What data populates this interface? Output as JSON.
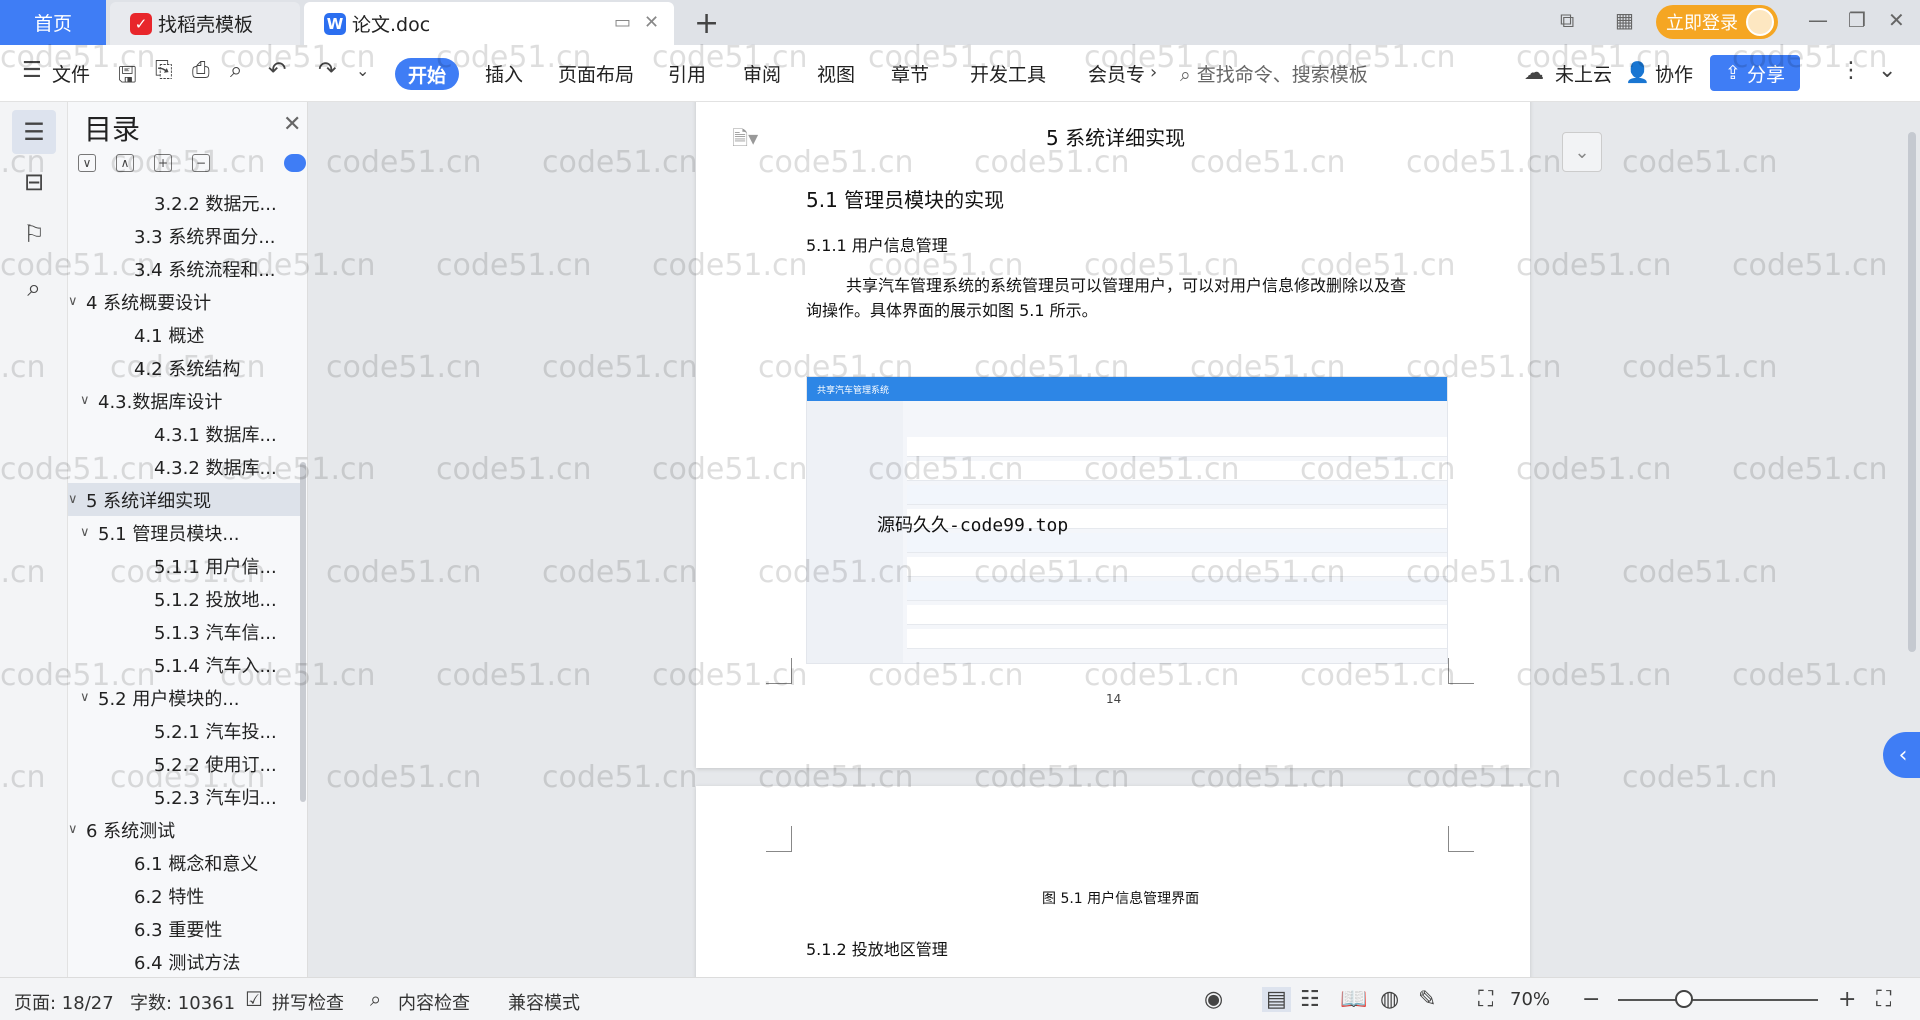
{
  "tabs": {
    "home": "首页",
    "daoke": "找稻壳模板",
    "doc": "论文.doc"
  },
  "titlebar": {
    "login": "立即登录"
  },
  "ribbon": {
    "file": "文件",
    "start": "开始",
    "insert": "插入",
    "layout": "页面布局",
    "reference": "引用",
    "review": "审阅",
    "view": "视图",
    "chapter": "章节",
    "devtools": "开发工具",
    "member": "会员专",
    "search_placeholder": "查找命令、搜索模板",
    "cloud": "未上云",
    "collab": "协作",
    "share": "分享"
  },
  "toc": {
    "title": "目录",
    "items": [
      {
        "label": "3.2.2 数据元...",
        "level": 3,
        "arrow": ""
      },
      {
        "label": "3.3 系统界面分...",
        "level": 2,
        "arrow": ""
      },
      {
        "label": "3.4 系统流程和...",
        "level": 2,
        "arrow": ""
      },
      {
        "label": "4 系统概要设计",
        "level": 1,
        "arrow": "∨"
      },
      {
        "label": "4.1 概述",
        "level": 2,
        "arrow": ""
      },
      {
        "label": "4.2 系统结构",
        "level": 2,
        "arrow": ""
      },
      {
        "label": "4.3.数据库设计",
        "level": 2,
        "arrow": "∨"
      },
      {
        "label": "4.3.1 数据库...",
        "level": 3,
        "arrow": ""
      },
      {
        "label": "4.3.2 数据库...",
        "level": 3,
        "arrow": ""
      },
      {
        "label": "5 系统详细实现",
        "level": 1,
        "arrow": "∨"
      },
      {
        "label": "5.1  管理员模块...",
        "level": 2,
        "arrow": "∨"
      },
      {
        "label": "5.1.1  用户信...",
        "level": 3,
        "arrow": ""
      },
      {
        "label": "5.1.2  投放地...",
        "level": 3,
        "arrow": ""
      },
      {
        "label": "5.1.3  汽车信...",
        "level": 3,
        "arrow": ""
      },
      {
        "label": "5.1.4  汽车入...",
        "level": 3,
        "arrow": ""
      },
      {
        "label": "5.2  用户模块的...",
        "level": 2,
        "arrow": "∨"
      },
      {
        "label": "5.2.1  汽车投...",
        "level": 3,
        "arrow": ""
      },
      {
        "label": "5.2.2  使用订...",
        "level": 3,
        "arrow": ""
      },
      {
        "label": "5.2.3  汽车归...",
        "level": 3,
        "arrow": ""
      },
      {
        "label": "6 系统测试",
        "level": 1,
        "arrow": "∨"
      },
      {
        "label": "6.1 概念和意义",
        "level": 2,
        "arrow": ""
      },
      {
        "label": "6.2 特性",
        "level": 2,
        "arrow": ""
      },
      {
        "label": "6.3 重要性",
        "level": 2,
        "arrow": ""
      },
      {
        "label": "6.4 测试方法",
        "level": 2,
        "arrow": ""
      }
    ],
    "selected_index": 9
  },
  "document": {
    "header": "5 系统详细实现",
    "h2": "5.1  管理员模块的实现",
    "h3": "5.1.1  用户信息管理",
    "para_line1": "共享汽车管理系统的系统管理员可以管理用户，可以对用户信息修改删除以及查",
    "para_line2": "询操作。具体界面的展示如图 5.1 所示。",
    "figure_app_title": "共享汽车管理系统",
    "figure_overlay": "源码久久-code99.top",
    "page_number": "14",
    "caption": "图 5.1  用户信息管理界面",
    "next_heading": "5.1.2  投放地区管理"
  },
  "watermark": "code51.cn",
  "status": {
    "page": "页面: 18/27",
    "words": "字数: 10361",
    "spell": "拼写检查",
    "content": "内容检查",
    "compat": "兼容模式",
    "zoom": "70%"
  }
}
